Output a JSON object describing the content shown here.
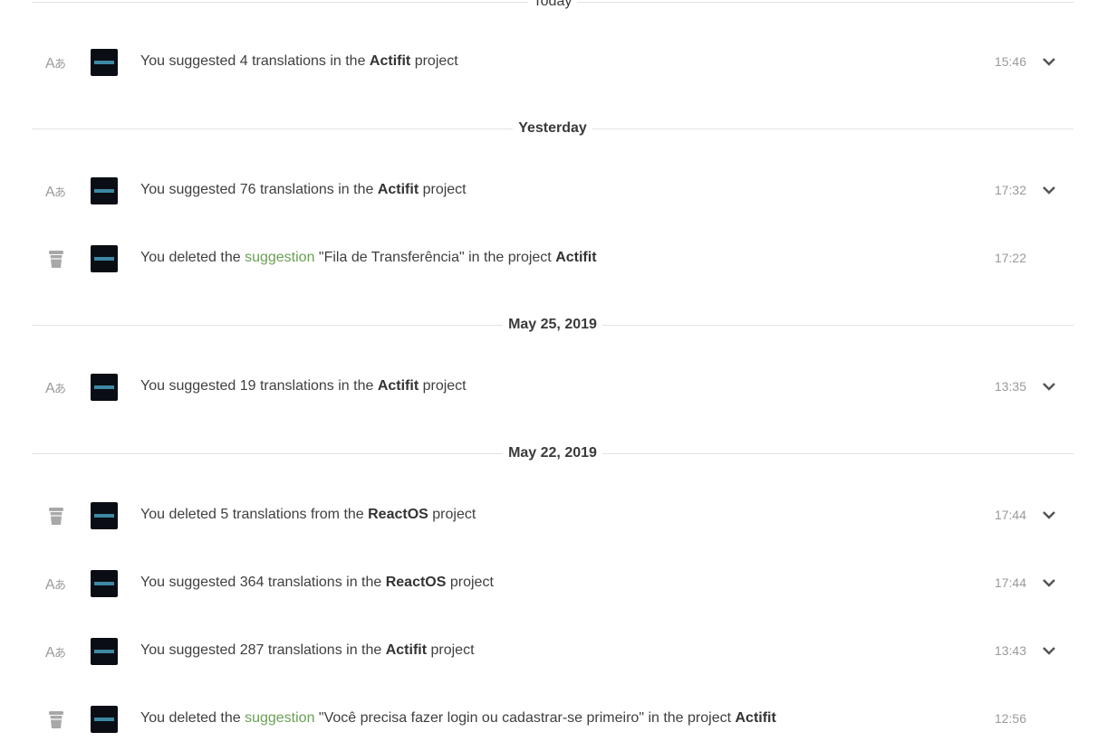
{
  "groups": [
    {
      "date": "Today"
    },
    {
      "date": "Yesterday"
    },
    {
      "date": "May 25, 2019"
    },
    {
      "date": "May 22, 2019"
    }
  ],
  "entries": [
    {
      "icon": "translate-icon",
      "parts": [
        "You suggested 4 translations in the ",
        "Actifit",
        " project"
      ],
      "time": "15:46",
      "expandable": true
    },
    {
      "icon": "translate-icon",
      "parts": [
        "You suggested 76 translations in the ",
        "Actifit",
        " project"
      ],
      "time": "17:32",
      "expandable": true
    },
    {
      "icon": "trash-icon",
      "parts": [
        "You deleted the ",
        "suggestion",
        " \"Fila de Transferência\" in the project ",
        "Actifit"
      ],
      "time": "17:22",
      "expandable": false
    },
    {
      "icon": "translate-icon",
      "parts": [
        "You suggested 19 translations in the ",
        "Actifit",
        " project"
      ],
      "time": "13:35",
      "expandable": true
    },
    {
      "icon": "trash-icon",
      "parts": [
        "You deleted 5 translations from the ",
        "ReactOS",
        " project"
      ],
      "time": "17:44",
      "expandable": true
    },
    {
      "icon": "translate-icon",
      "parts": [
        "You suggested 364 translations in the ",
        "ReactOS",
        " project"
      ],
      "time": "17:44",
      "expandable": true
    },
    {
      "icon": "translate-icon",
      "parts": [
        "You suggested 287 translations in the ",
        "Actifit",
        " project"
      ],
      "time": "13:43",
      "expandable": true
    },
    {
      "icon": "trash-icon",
      "parts": [
        "You deleted the ",
        "suggestion",
        " \"Você precisa fazer login ou cadastrar-se primeiro\" in the project ",
        "Actifit"
      ],
      "time": "12:56",
      "expandable": false
    }
  ],
  "colors": {
    "link": "#6a9f55",
    "muted": "#9a9a9a"
  }
}
